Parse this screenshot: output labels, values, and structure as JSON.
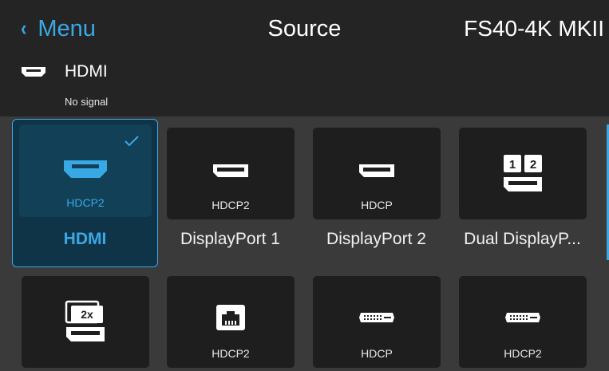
{
  "header": {
    "back_label": "Menu",
    "title": "Source",
    "model": "FS40-4K MKII"
  },
  "current_source": {
    "icon": "hdmi-icon",
    "name": "HDMI",
    "status": "No signal"
  },
  "sources": [
    {
      "name": "HDMI",
      "hdcp": "HDCP2",
      "icon": "hdmi-icon",
      "selected": true
    },
    {
      "name": "DisplayPort 1",
      "hdcp": "HDCP2",
      "icon": "displayport-icon",
      "selected": false
    },
    {
      "name": "DisplayPort 2",
      "hdcp": "HDCP",
      "icon": "displayport-icon",
      "selected": false
    },
    {
      "name": "Dual DisplayP...",
      "hdcp": "",
      "icon": "dual-displayport-icon",
      "selected": false
    },
    {
      "name": "",
      "hdcp": "",
      "icon": "2x-displayport-icon",
      "selected": false
    },
    {
      "name": "",
      "hdcp": "HDCP2",
      "icon": "hdbaset-icon",
      "selected": false
    },
    {
      "name": "",
      "hdcp": "HDCP",
      "icon": "dvi-icon",
      "selected": false
    },
    {
      "name": "",
      "hdcp": "HDCP2",
      "icon": "dvi-icon",
      "selected": false
    }
  ],
  "colors": {
    "accent": "#39a9e6",
    "header_bg": "#242424",
    "body_bg": "#3a3a3a",
    "tile_bg": "#1e1e1e"
  }
}
